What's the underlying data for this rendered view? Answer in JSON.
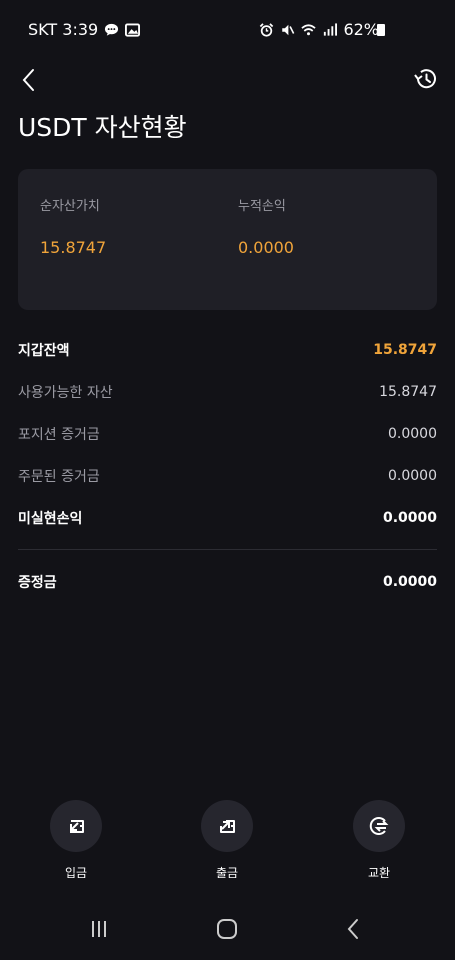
{
  "status_bar": {
    "carrier_time": "SKT 3:39",
    "battery": "62%"
  },
  "header": {
    "title": "USDT 자산현황"
  },
  "summary": {
    "net_asset_label": "순자산가치",
    "net_asset_value": "15.8747",
    "cumulative_pnl_label": "누적손익",
    "cumulative_pnl_value": "0.0000"
  },
  "details": [
    {
      "label": "지갑잔액",
      "value": "15.8747"
    },
    {
      "label": "사용가능한 자산",
      "value": "15.8747"
    },
    {
      "label": "포지션 증거금",
      "value": "0.0000"
    },
    {
      "label": "주문된 증거금",
      "value": "0.0000"
    },
    {
      "label": "미실현손익",
      "value": "0.0000"
    },
    {
      "label": "증정금",
      "value": "0.0000"
    }
  ],
  "actions": [
    {
      "label": "입금",
      "icon": "deposit-icon"
    },
    {
      "label": "출금",
      "icon": "withdraw-icon"
    },
    {
      "label": "교환",
      "icon": "exchange-icon"
    }
  ],
  "colors": {
    "background": "#121217",
    "card": "#1f1f26",
    "accent": "#f0a43a",
    "muted": "#9a9aa3"
  }
}
